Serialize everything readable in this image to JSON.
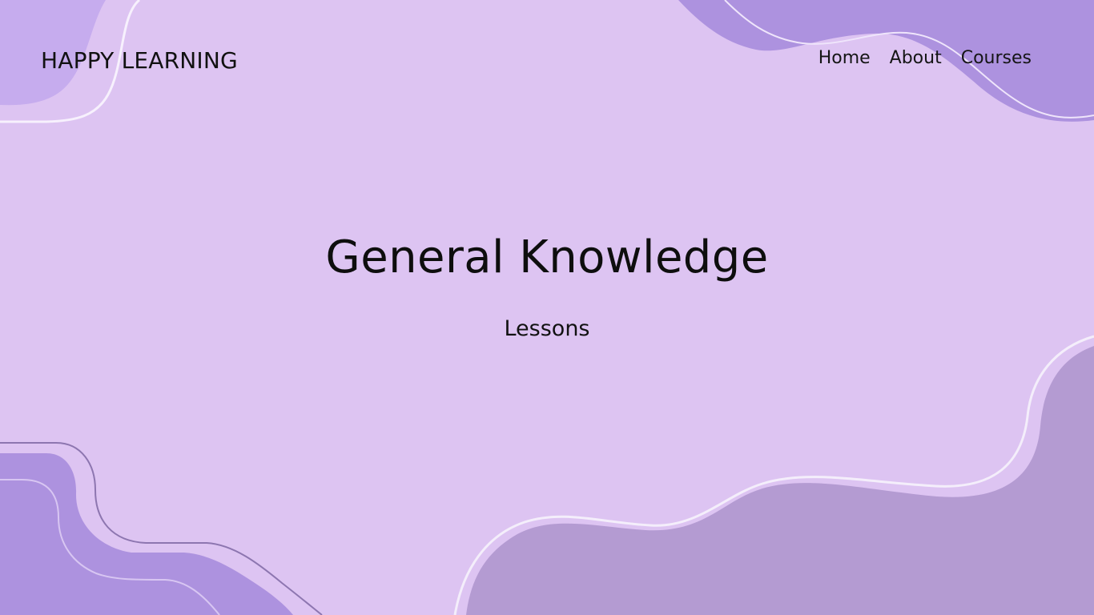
{
  "brand": {
    "name": "HAPPY LEARNING"
  },
  "nav": {
    "items": [
      {
        "label": "Home"
      },
      {
        "label": "About"
      },
      {
        "label": "Courses"
      }
    ]
  },
  "hero": {
    "title": "General Knowledge",
    "subtitle": "Lessons"
  },
  "colors": {
    "background": "#ddc4f2",
    "blob_dark": "#ad92df",
    "blob_muted": "#b49bd2",
    "outline": "#f4eefb",
    "text": "#111111"
  },
  "icons": [
    "decorative-wave-shapes"
  ]
}
